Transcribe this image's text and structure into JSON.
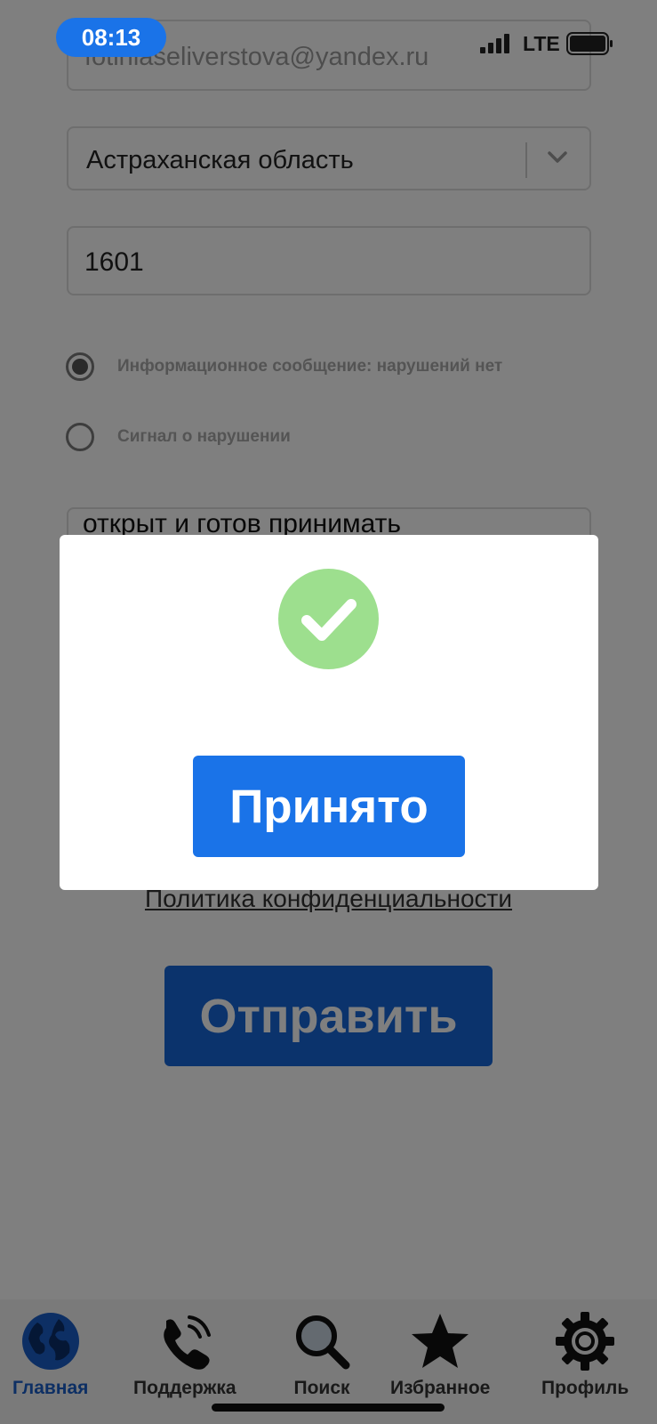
{
  "status_bar": {
    "time": "08:13",
    "network": "LTE"
  },
  "form": {
    "email": "fotiniaseliverstova@yandex.ru",
    "region": "Астраханская область",
    "number": "1601",
    "radio_options": [
      {
        "label": "Информационное сообщение: нарушений нет",
        "selected": true
      },
      {
        "label": "Сигнал о нарушении",
        "selected": false
      }
    ],
    "message": "открыт и готов принимать",
    "privacy_link": "Политика конфиденциальности",
    "submit_label": "Отправить"
  },
  "modal": {
    "icon": "check-circle-icon",
    "icon_color": "#9ddf8e",
    "button_label": "Принято"
  },
  "tab_bar": {
    "items": [
      {
        "label": "Главная",
        "icon": "globe-icon",
        "active": true
      },
      {
        "label": "Поддержка",
        "icon": "phone-icon",
        "active": false
      },
      {
        "label": "Поиск",
        "icon": "search-icon",
        "active": false
      },
      {
        "label": "Избранное",
        "icon": "star-icon",
        "active": false
      },
      {
        "label": "Профиль",
        "icon": "gear-icon",
        "active": false
      }
    ]
  },
  "colors": {
    "accent": "#1a73e8",
    "submit": "#1766d8",
    "active_tab": "#1b5fc8"
  }
}
